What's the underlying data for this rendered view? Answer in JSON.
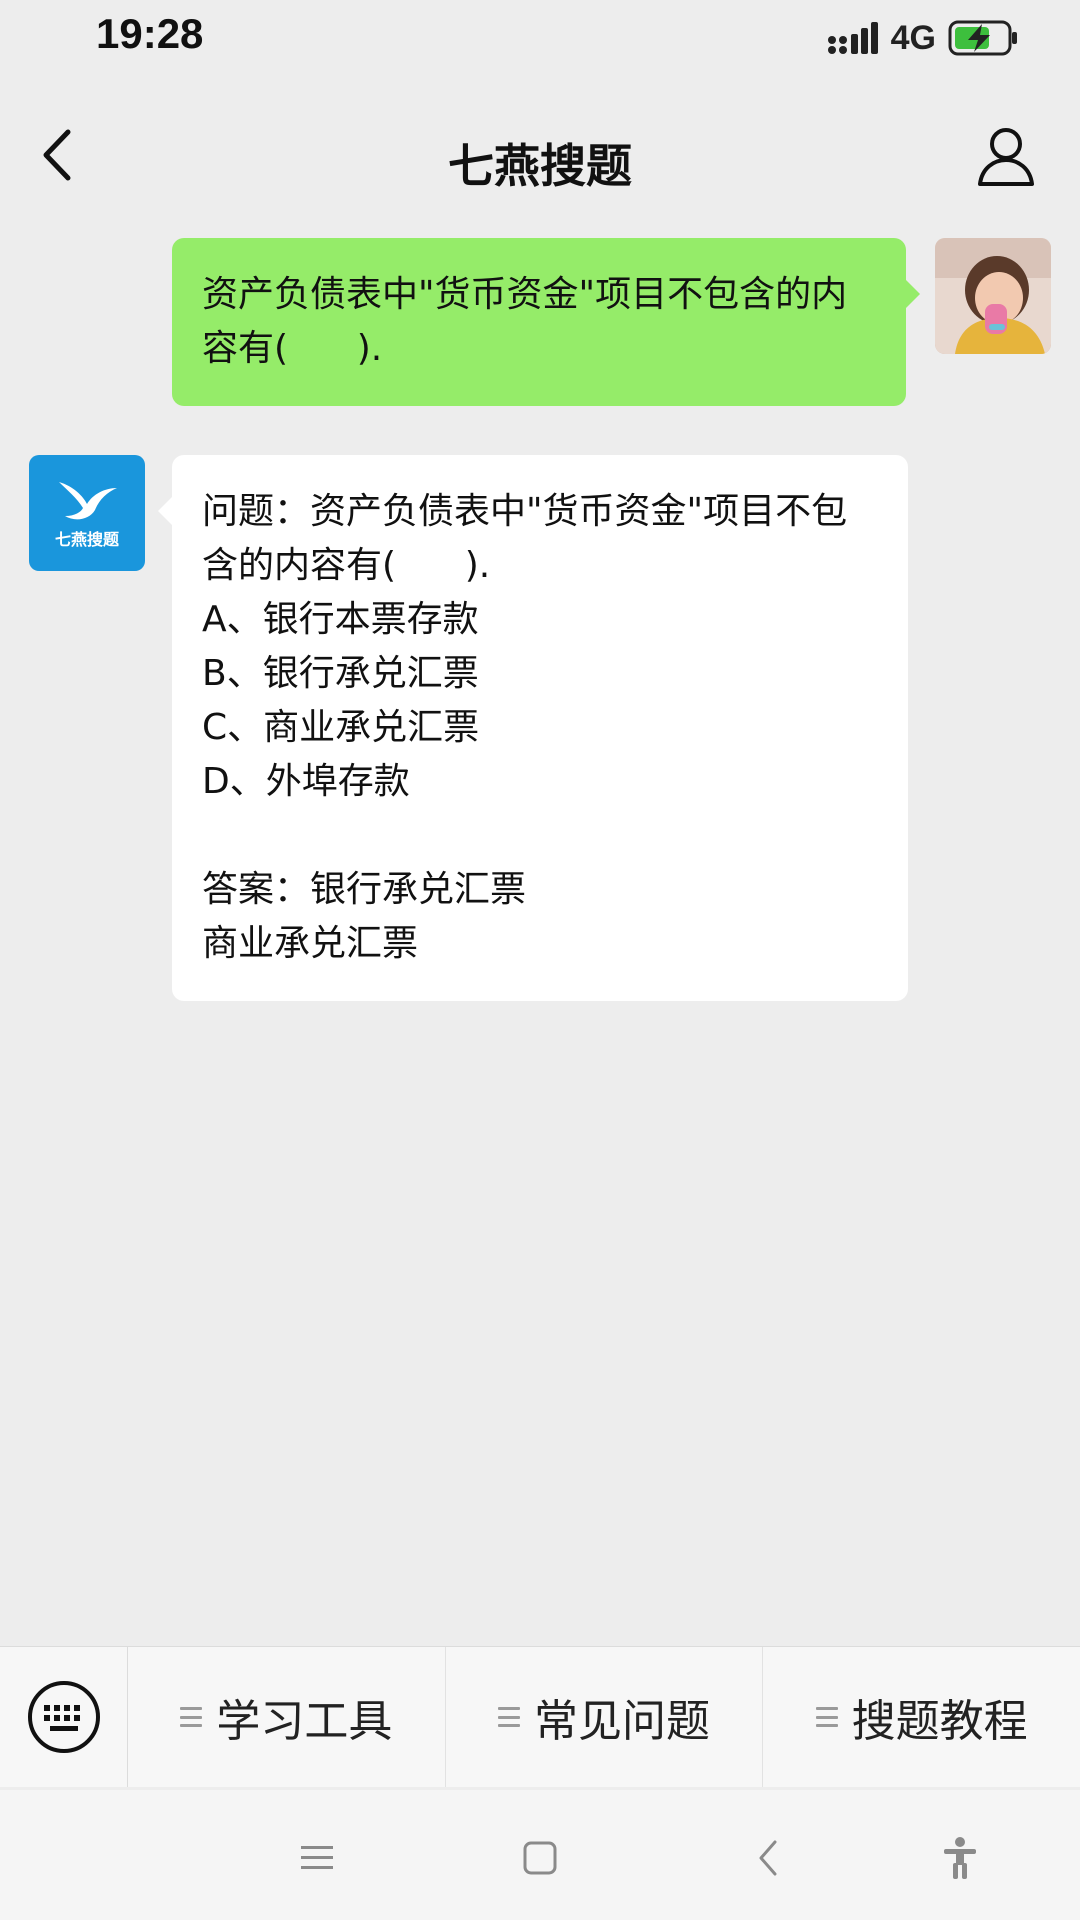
{
  "status_bar": {
    "time": "19:28",
    "network": "4G",
    "battery_state": "charging"
  },
  "nav": {
    "title": "七燕搜题",
    "back_icon": "chevron-left-icon",
    "profile_icon": "user-icon"
  },
  "messages": {
    "user": {
      "text": "资产负债表中\"货币资金\"项目不包含的内容有(      )."
    },
    "bot": {
      "logo_text": "七燕搜题",
      "question": "问题：资产负债表中\"货币资金\"项目不包含的内容有(      ).",
      "options": [
        "A、银行本票存款",
        "B、银行承兑汇票",
        "C、商业承兑汇票",
        "D、外埠存款"
      ],
      "answer_line1": "答案：银行承兑汇票",
      "answer_line2": "商业承兑汇票"
    }
  },
  "bottom_menu": {
    "keyboard_icon": "keyboard-icon",
    "items": [
      {
        "label": "学习工具"
      },
      {
        "label": "常见问题"
      },
      {
        "label": "搜题教程"
      }
    ]
  },
  "colors": {
    "user_bubble": "#95ec69",
    "bot_avatar": "#1a96dc",
    "background": "#ededed"
  }
}
